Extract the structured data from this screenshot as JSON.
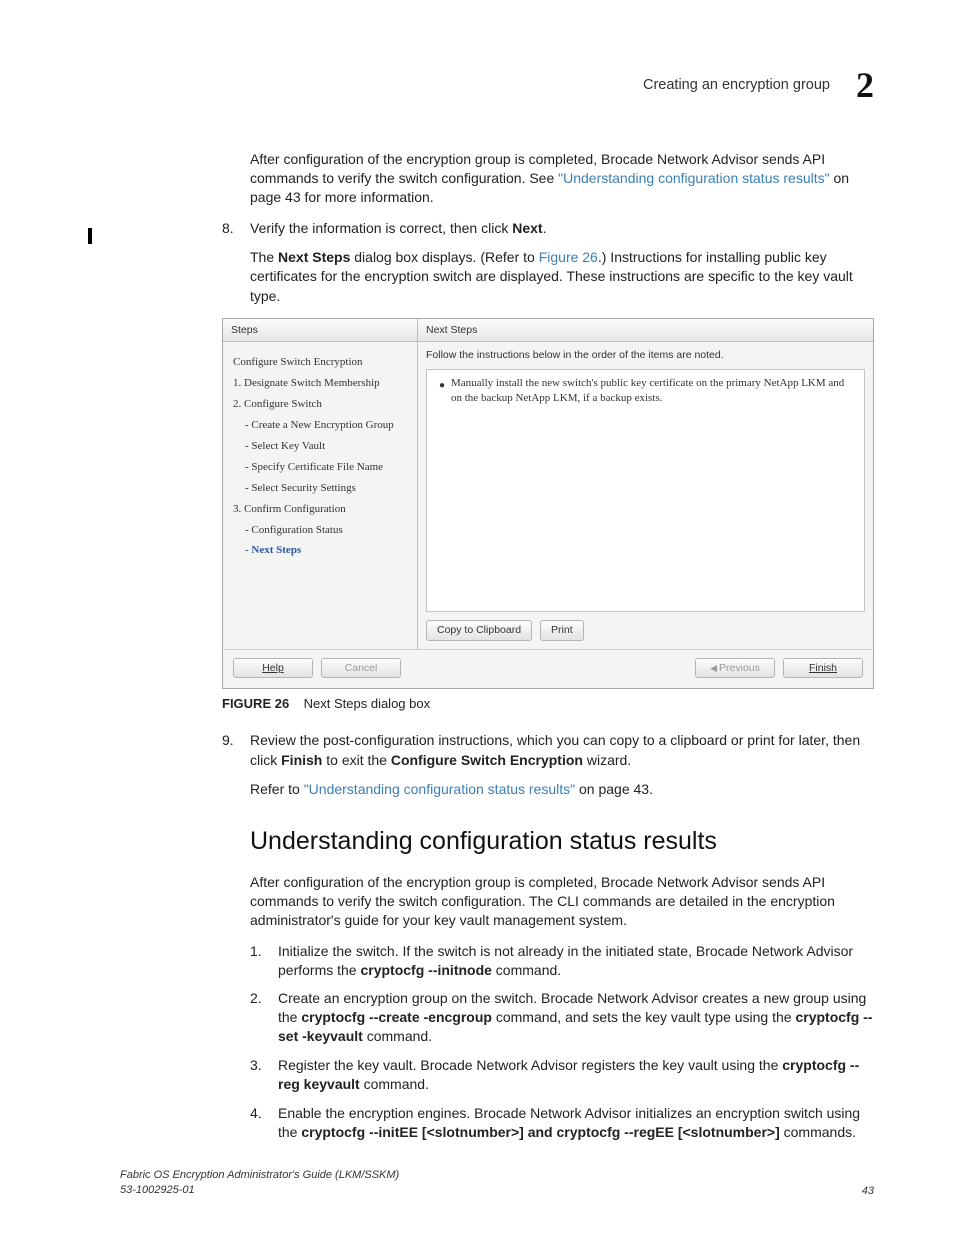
{
  "header": {
    "section": "Creating an encryption group",
    "chapter": "2"
  },
  "body": {
    "p1a": "After configuration of the encryption group is completed, Brocade Network Advisor sends API commands to verify the switch configuration. See ",
    "p1link": "\"Understanding configuration status results\"",
    "p1b": " on page 43 for more information.",
    "s8num": "8.",
    "s8a": "Verify the information is correct, then click ",
    "s8b": "Next",
    "s8c": ".",
    "s8sub_a": "The ",
    "s8sub_b": "Next Steps",
    "s8sub_c": " dialog box displays. (Refer to ",
    "s8sub_link": "Figure 26",
    "s8sub_d": ".) Instructions for installing public key certificates for the encryption switch are displayed. These instructions are specific to the key vault type.",
    "figcap_b": "FIGURE 26",
    "figcap_t": "Next Steps dialog box",
    "s9num": "9.",
    "s9a": "Review the post-configuration instructions, which you can copy to a clipboard or print for later, then click ",
    "s9b": "Finish",
    "s9c": " to exit the ",
    "s9d": "Configure Switch Encryption",
    "s9e": " wizard.",
    "s9sub_a": "Refer to ",
    "s9sub_link": "\"Understanding configuration status results\"",
    "s9sub_b": " on page 43.",
    "h2": "Understanding configuration status results",
    "p2": "After configuration of the encryption group is completed, Brocade Network Advisor sends API commands to verify the switch configuration. The CLI commands are detailed in the encryption administrator's guide for your key vault management system.",
    "li1n": "1.",
    "li1a": "Initialize the switch. If the switch is not already in the initiated state, Brocade Network Advisor performs the ",
    "li1b": "cryptocfg --initnode",
    "li1c": " command.",
    "li2n": "2.",
    "li2a": "Create an encryption group on the switch. Brocade Network Advisor creates a new group using the ",
    "li2b": "cryptocfg --create  -encgroup",
    "li2c": " command, and sets the key vault type using the ",
    "li2d": "cryptocfg --set   -keyvault",
    "li2e": " command.",
    "li3n": "3.",
    "li3a": "Register the key vault. Brocade Network Advisor registers the key vault using the ",
    "li3b": "cryptocfg --reg keyvault",
    "li3c": " command.",
    "li4n": "4.",
    "li4a": "Enable the encryption engines. Brocade Network Advisor initializes an encryption switch using the ",
    "li4b": "cryptocfg  --initEE [<slotnumber>] and cryptocfg  --regEE [<slotnumber>]",
    "li4c": " commands."
  },
  "dialog": {
    "left_h": "Steps",
    "right_h": "Next Steps",
    "t0": "Configure Switch Encryption",
    "t1": "1. Designate Switch Membership",
    "t2": "2. Configure Switch",
    "t2a": "- Create a New Encryption Group",
    "t2b": "- Select Key Vault",
    "t2c": "- Specify Certificate File Name",
    "t2d": "- Select Security Settings",
    "t3": "3. Confirm Configuration",
    "t3a": "- Configuration Status",
    "t3b": "- Next Steps",
    "instr": "Follow the instructions below in the order of the items are noted.",
    "bullet": "Manually install the new switch's public key certificate on the primary NetApp LKM and on the backup NetApp LKM, if a backup exists.",
    "btn_copy": "Copy to Clipboard",
    "btn_print": "Print",
    "btn_help": "Help",
    "btn_cancel": "Cancel",
    "btn_prev": "Previous",
    "btn_finish": "Finish"
  },
  "footer": {
    "l1": "Fabric OS Encryption Administrator's Guide  (LKM/SSKM)",
    "l2": "53-1002925-01",
    "page": "43"
  }
}
